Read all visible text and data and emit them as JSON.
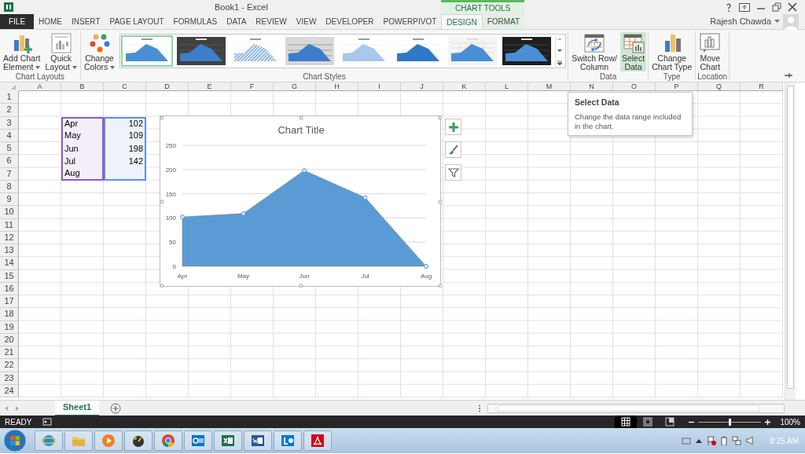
{
  "window": {
    "title": "Book1 - Excel",
    "context_label": "CHART TOOLS",
    "user": "Rajesh Chawda"
  },
  "tabs": [
    {
      "label": "FILE",
      "kind": "file",
      "selected": false
    },
    {
      "label": "HOME",
      "kind": "main",
      "selected": false
    },
    {
      "label": "INSERT",
      "kind": "main",
      "selected": false
    },
    {
      "label": "PAGE LAYOUT",
      "kind": "main",
      "selected": false
    },
    {
      "label": "FORMULAS",
      "kind": "main",
      "selected": false
    },
    {
      "label": "DATA",
      "kind": "main",
      "selected": false
    },
    {
      "label": "REVIEW",
      "kind": "main",
      "selected": false
    },
    {
      "label": "VIEW",
      "kind": "main",
      "selected": false
    },
    {
      "label": "DEVELOPER",
      "kind": "main",
      "selected": false
    },
    {
      "label": "POWERPIVOT",
      "kind": "main",
      "selected": false
    },
    {
      "label": "DESIGN",
      "kind": "contextual",
      "selected": true
    },
    {
      "label": "FORMAT",
      "kind": "contextual",
      "selected": false
    }
  ],
  "ribbon": {
    "groups": [
      {
        "label": "Chart Layouts",
        "buttons": [
          {
            "lines": [
              "Add Chart",
              "Element"
            ],
            "kind": "add-element",
            "dropdown": true,
            "hovered": false
          },
          {
            "lines": [
              "Quick",
              "Layout"
            ],
            "kind": "quick-layout",
            "dropdown": true,
            "hovered": false
          }
        ]
      },
      {
        "label": "Chart Styles",
        "buttons": [
          {
            "lines": [
              "Change",
              "Colors"
            ],
            "kind": "colors",
            "dropdown": true,
            "hovered": false
          }
        ],
        "styles": [
          {
            "kind": "light",
            "selected": true
          },
          {
            "kind": "dark",
            "selected": false
          },
          {
            "kind": "hatched",
            "selected": false
          },
          {
            "kind": "gray",
            "selected": false
          },
          {
            "kind": "pale",
            "selected": false
          },
          {
            "kind": "shaded",
            "selected": false
          },
          {
            "kind": "grid",
            "selected": false
          },
          {
            "kind": "black",
            "selected": false
          }
        ]
      },
      {
        "label": "Data",
        "buttons": [
          {
            "lines": [
              "Switch Row/",
              "Column"
            ],
            "kind": "switch",
            "dropdown": false,
            "hovered": false
          },
          {
            "lines": [
              "Select",
              "Data"
            ],
            "kind": "select-data",
            "dropdown": false,
            "hovered": true
          }
        ]
      },
      {
        "label": "Type",
        "buttons": [
          {
            "lines": [
              "Change",
              "Chart Type"
            ],
            "kind": "chart-type",
            "dropdown": false,
            "hovered": false
          }
        ]
      },
      {
        "label": "Location",
        "buttons": [
          {
            "lines": [
              "Move",
              "Chart"
            ],
            "kind": "move-chart",
            "dropdown": false,
            "hovered": false
          }
        ]
      }
    ]
  },
  "tooltip": {
    "title": "Select Data",
    "text": "Change the data range included in the chart."
  },
  "sheet": {
    "columns": [
      "A",
      "B",
      "C",
      "D",
      "E",
      "F",
      "G",
      "H",
      "I",
      "J",
      "K",
      "L",
      "M",
      "N",
      "O",
      "P",
      "Q",
      "R"
    ],
    "row_numbers": [
      "1",
      "2",
      "3",
      "4",
      "5",
      "6",
      "7",
      "8",
      "9",
      "10",
      "11",
      "12",
      "13",
      "14",
      "15",
      "16",
      "17",
      "18",
      "19",
      "20",
      "21",
      "22",
      "23",
      "24"
    ],
    "data": [
      {
        "label": "Apr",
        "value": "102"
      },
      {
        "label": "May",
        "value": "109"
      },
      {
        "label": "Jun",
        "value": "198"
      },
      {
        "label": "Jul",
        "value": "142"
      },
      {
        "label": "Aug"
      }
    ]
  },
  "chart": {
    "chart_data": {
      "type": "area",
      "grid": true,
      "title": "Chart Title",
      "categories": [
        "Apr",
        "May",
        "Jun",
        "Jul",
        "Aug"
      ],
      "values": [
        102,
        109,
        198,
        142,
        0
      ],
      "ylim": [
        0,
        250
      ],
      "yticks": [
        0,
        50,
        100,
        150,
        200,
        250
      ]
    }
  },
  "sheet_tabs": [
    {
      "label": "Sheet1",
      "selected": true
    }
  ],
  "status_bar": {
    "mode": "READY",
    "views": [
      {
        "kind": "normal",
        "selected": true
      },
      {
        "kind": "page-layout",
        "selected": false
      },
      {
        "kind": "page-break",
        "selected": false
      }
    ],
    "zoom": {
      "level": 0.5,
      "reading": "100%"
    }
  },
  "taskbar": {
    "apps": [
      {
        "kind": "ie"
      },
      {
        "kind": "folder"
      },
      {
        "kind": "media"
      },
      {
        "kind": "gadget"
      },
      {
        "kind": "chrome"
      },
      {
        "kind": "outlook"
      },
      {
        "kind": "excel"
      },
      {
        "kind": "word"
      },
      {
        "kind": "lync"
      },
      {
        "kind": "pdf"
      }
    ],
    "clock": "8:25 AM"
  }
}
